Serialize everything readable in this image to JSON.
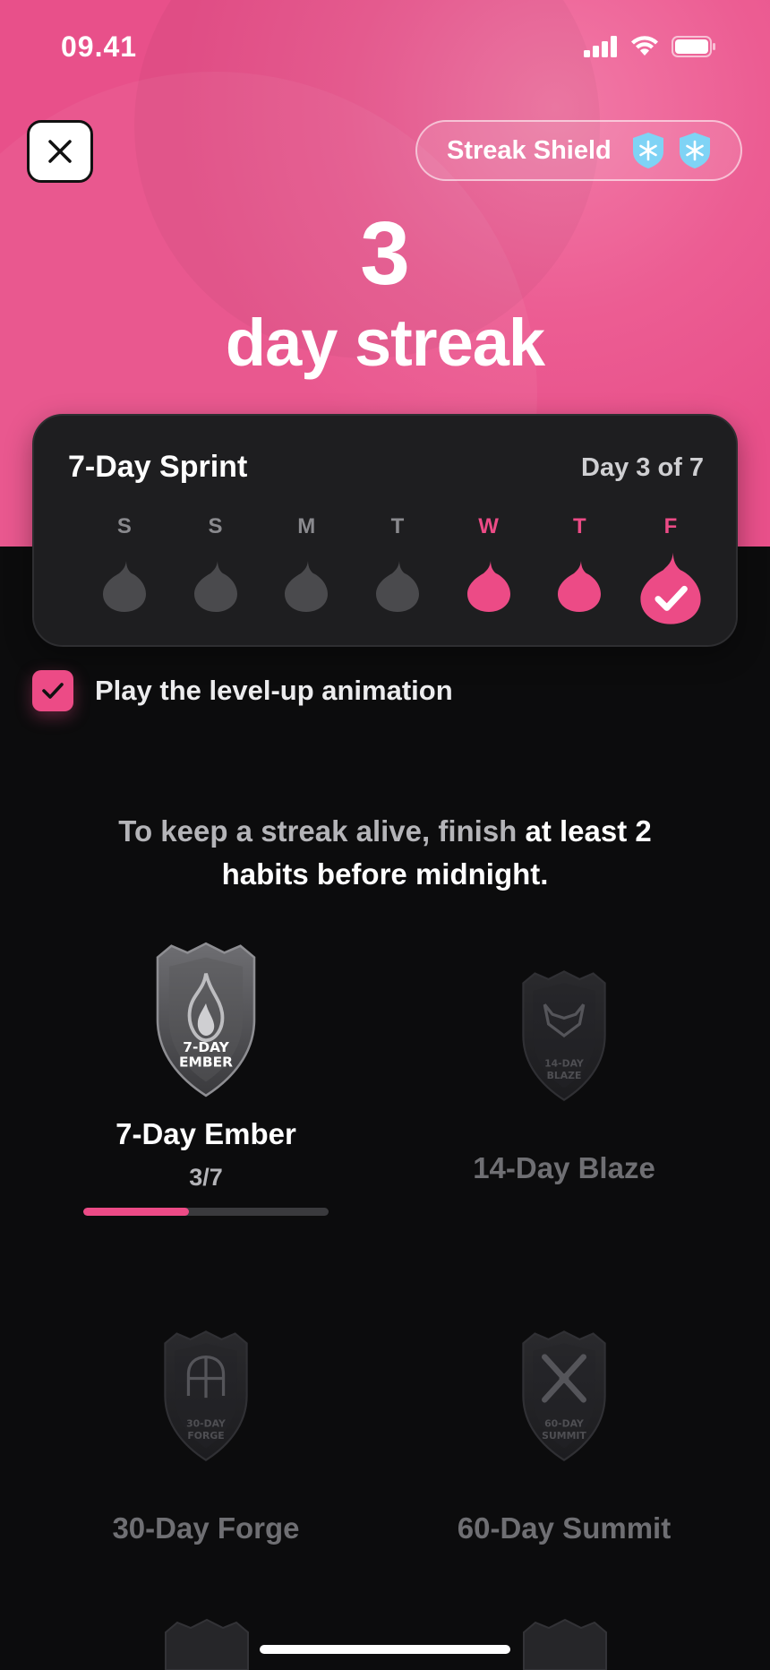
{
  "status_bar": {
    "time": "09.41"
  },
  "header": {
    "close_icon": "close-icon",
    "shield_label": "Streak Shield",
    "shield_count": 2,
    "shield_icon": "snowflake-shield-icon"
  },
  "streak": {
    "count": "3",
    "label": "day streak"
  },
  "sprint": {
    "title": "7-Day Sprint",
    "progress_text": "Day 3 of 7",
    "days": [
      {
        "letter": "S",
        "state": "inactive"
      },
      {
        "letter": "S",
        "state": "inactive"
      },
      {
        "letter": "M",
        "state": "inactive"
      },
      {
        "letter": "T",
        "state": "inactive"
      },
      {
        "letter": "W",
        "state": "done"
      },
      {
        "letter": "T",
        "state": "done"
      },
      {
        "letter": "F",
        "state": "today"
      }
    ]
  },
  "animation_toggle": {
    "label": "Play the level-up animation",
    "checked": true
  },
  "hint": {
    "part1": "To keep a streak alive, finish ",
    "part2": "at least 2 habits before midnight."
  },
  "badges": [
    {
      "name": "7-Day Ember",
      "emblem": "7-DAY\nEMBER",
      "progress": "3/7",
      "progress_fraction": 0.43,
      "unlocked": true,
      "icon": "flame-icon"
    },
    {
      "name": "14-Day Blaze",
      "emblem": "14-DAY\nBLAZE",
      "unlocked": false,
      "icon": "fox-icon"
    },
    {
      "name": "30-Day Forge",
      "emblem": "30-DAY\nFORGE",
      "unlocked": false,
      "icon": "helmet-icon"
    },
    {
      "name": "60-Day Summit",
      "emblem": "60-DAY\nSUMMIT",
      "unlocked": false,
      "icon": "crossed-swords-icon"
    }
  ],
  "colors": {
    "accent": "#ec4b86",
    "hero": "#e8508a",
    "background": "#0c0c0d",
    "card": "#1e1e20"
  }
}
